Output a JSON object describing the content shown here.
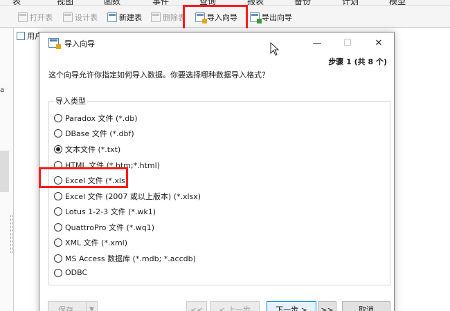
{
  "menubar": {
    "items": [
      "表",
      "视图",
      "函数",
      "事件",
      "查询",
      "报表",
      "备份",
      "计划",
      "模型"
    ]
  },
  "toolbar": {
    "buttons": [
      {
        "label": "打开表",
        "icon": "open-table-icon",
        "enabled": false
      },
      {
        "label": "设计表",
        "icon": "design-table-icon",
        "enabled": false
      },
      {
        "label": "新建表",
        "icon": "new-table-icon",
        "enabled": true
      },
      {
        "label": "删除表",
        "icon": "delete-table-icon",
        "enabled": false
      },
      {
        "label": "导入向导",
        "icon": "import-wizard-icon",
        "enabled": true,
        "highlighted": true
      },
      {
        "label": "导出向导",
        "icon": "export-wizard-icon",
        "enabled": true
      }
    ]
  },
  "background": {
    "tab_label": "用户",
    "left_label": "a"
  },
  "dialog": {
    "title": "导入向导",
    "minimize": "—",
    "maximize": "☐",
    "close": "✕",
    "step": "步骤 1 (共 8 个)",
    "description": "这个向导允许你指定如何导入数据。你要选择哪种数据导入格式？",
    "group_label": "导入类型",
    "options": [
      {
        "label": "Paradox 文件 (*.db)",
        "selected": false
      },
      {
        "label": "DBase 文件 (*.dbf)",
        "selected": false
      },
      {
        "label": "文本文件 (*.txt)",
        "selected": true
      },
      {
        "label": "HTML 文件 (*.htm;*.html)",
        "selected": false
      },
      {
        "label": "Excel 文件 (*.xls)",
        "selected": false,
        "highlighted": true
      },
      {
        "label": "Excel 文件 (2007 或以上版本) (*.xlsx)",
        "selected": false
      },
      {
        "label": "Lotus 1-2-3 文件 (*.wk1)",
        "selected": false
      },
      {
        "label": "QuattroPro 文件 (*.wq1)",
        "selected": false
      },
      {
        "label": "XML 文件 (*.xml)",
        "selected": false
      },
      {
        "label": "MS Access 数据库 (*.mdb; *.accdb)",
        "selected": false
      },
      {
        "label": "ODBC",
        "selected": false
      }
    ],
    "footer": {
      "save": "保存",
      "save_caret": "▼",
      "first": "<<",
      "prev": "< 上一步",
      "next": "下一步 >",
      "last": ">>",
      "cancel": "取消"
    }
  },
  "colors": {
    "highlight": "#ff1a1a",
    "accent": "#0078d7"
  }
}
